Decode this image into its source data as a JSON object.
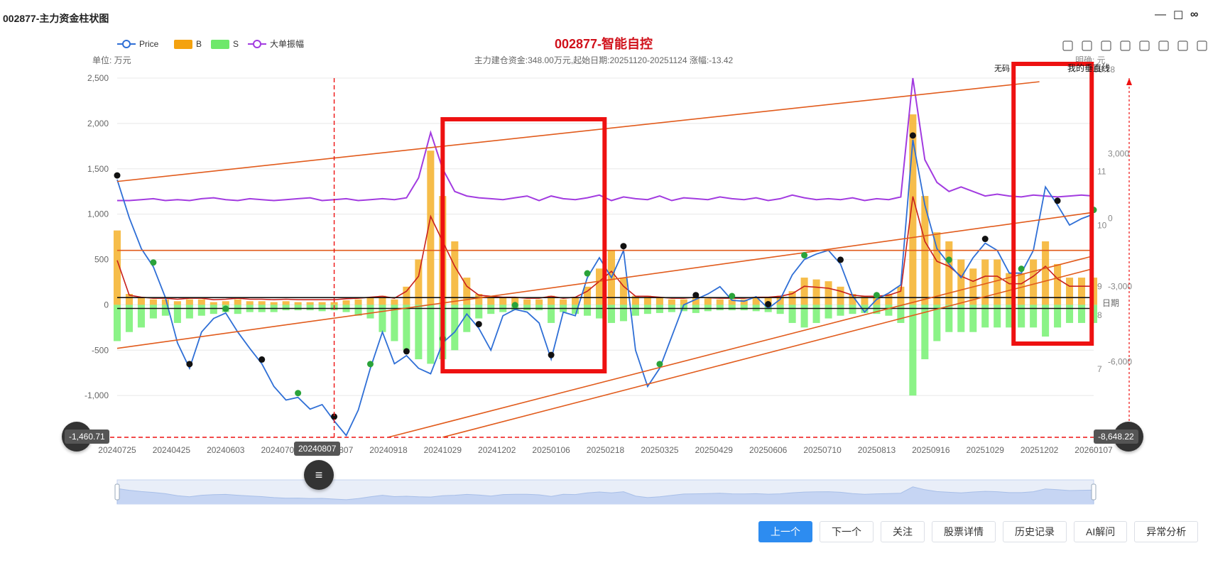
{
  "window": {
    "title": "002877-主力资金柱状图",
    "minimize_glyph": "—",
    "maximize_glyph": "☐",
    "extra_glyph": "∞"
  },
  "chart": {
    "title": "002877-智能自控",
    "subtitle": "主力建仓资金:348.00万元,起始日期:20251120-20251124 涨幅:-13.42",
    "unit_left": "单位: 万元",
    "unit_right": "明确: 元",
    "right_top_value": "58.78",
    "right_axis_label": "日期",
    "vertical_line_label": "我的垂直线",
    "peak_label": "无码",
    "legend": [
      {
        "name": "Price",
        "color": "#2f6fd6",
        "shape": "line"
      },
      {
        "name": "B",
        "color": "#f4a20f",
        "shape": "rect"
      },
      {
        "name": "S",
        "color": "#6ee86a",
        "shape": "rect"
      },
      {
        "name": "大单振幅",
        "color": "#a23be0",
        "shape": "line"
      }
    ],
    "toolbox_icons": [
      "layers-icon",
      "document-icon",
      "zoom-rect-icon",
      "lasso-icon",
      "move-icon",
      "restore-icon",
      "copy-icon",
      "close-box-icon"
    ],
    "crosshair_left_value": "-1,460.71",
    "crosshair_right_value": "-8,648.22",
    "crosshair_date": "20240807",
    "highlight_color": "#ee1111"
  },
  "chart_data": {
    "type": "bar",
    "x_ticks": [
      "20240725",
      "20240425",
      "20240603",
      "20240708",
      "20240807",
      "20240918",
      "20241029",
      "20241202",
      "20250106",
      "20250218",
      "20250325",
      "20250429",
      "20250606",
      "20250710",
      "20250813",
      "20250916",
      "20251029",
      "20251202",
      "20260107"
    ],
    "y_left": {
      "ticks": [
        2500,
        2000,
        1500,
        1000,
        500,
        0,
        -500,
        -1000
      ],
      "labels": [
        "2,500",
        "2,000",
        "1,500",
        "1,000",
        "500",
        "0",
        "-500",
        "-1,000"
      ],
      "ylim": [
        -1460.71,
        2500
      ]
    },
    "y_right_amount": {
      "labels": [
        "3,000",
        "-3,000",
        "-6,000"
      ]
    },
    "y_right_price": {
      "labels": [
        "11",
        "10",
        "9",
        "8",
        "7"
      ]
    },
    "y_right_amp": {
      "labels": [
        "0"
      ]
    },
    "series": [
      {
        "name": "Price",
        "values": [
          1380,
          960,
          620,
          420,
          80,
          -420,
          -700,
          -300,
          -150,
          -90,
          -300,
          -480,
          -650,
          -900,
          -1050,
          -1020,
          -1150,
          -1100,
          -1280,
          -1440,
          -1160,
          -700,
          -300,
          -650,
          -560,
          -700,
          -760,
          -420,
          -300,
          -100,
          -260,
          -500,
          -120,
          -50,
          -80,
          -200,
          -600,
          -80,
          -120,
          300,
          520,
          300,
          600,
          -500,
          -900,
          -700,
          -350,
          0,
          60,
          120,
          200,
          50,
          40,
          90,
          -40,
          60,
          330,
          500,
          560,
          600,
          450,
          100,
          -80,
          60,
          130,
          220,
          1820,
          1100,
          620,
          450,
          300,
          520,
          680,
          600,
          350,
          350,
          600,
          1300,
          1100,
          880,
          950,
          1000
        ]
      },
      {
        "name": "B",
        "values": [
          820,
          120,
          80,
          60,
          60,
          40,
          60,
          60,
          30,
          40,
          60,
          40,
          40,
          30,
          40,
          30,
          30,
          30,
          30,
          50,
          60,
          80,
          100,
          60,
          200,
          500,
          1700,
          1200,
          700,
          300,
          120,
          100,
          80,
          80,
          60,
          60,
          100,
          60,
          80,
          200,
          400,
          600,
          300,
          100,
          100,
          80,
          60,
          60,
          80,
          70,
          60,
          60,
          60,
          80,
          80,
          100,
          150,
          300,
          280,
          260,
          200,
          120,
          100,
          100,
          120,
          200,
          2100,
          1200,
          800,
          700,
          500,
          400,
          500,
          500,
          350,
          350,
          500,
          700,
          450,
          300,
          300,
          300
        ]
      },
      {
        "name": "S",
        "values": [
          -400,
          -300,
          -250,
          -150,
          -120,
          -200,
          -150,
          -120,
          -100,
          -80,
          -100,
          -80,
          -80,
          -80,
          -60,
          -60,
          -60,
          -70,
          -60,
          -80,
          -120,
          -150,
          -300,
          -400,
          -500,
          -600,
          -650,
          -600,
          -500,
          -300,
          -150,
          -100,
          -80,
          -60,
          -60,
          -60,
          -200,
          -80,
          -100,
          -120,
          -150,
          -200,
          -180,
          -120,
          -100,
          -90,
          -80,
          -70,
          -90,
          -70,
          -60,
          -60,
          -60,
          -70,
          -80,
          -100,
          -200,
          -250,
          -200,
          -150,
          -120,
          -100,
          -90,
          -100,
          -120,
          -200,
          -1000,
          -600,
          -400,
          -300,
          -300,
          -300,
          -250,
          -250,
          -250,
          -250,
          -250,
          -350,
          -250,
          -200,
          -200,
          -200
        ]
      },
      {
        "name": "大单振幅",
        "values": [
          1150,
          1150,
          1160,
          1170,
          1150,
          1160,
          1150,
          1170,
          1180,
          1160,
          1150,
          1170,
          1160,
          1150,
          1160,
          1170,
          1180,
          1150,
          1160,
          1170,
          1150,
          1160,
          1170,
          1160,
          1180,
          1400,
          1900,
          1500,
          1250,
          1200,
          1180,
          1170,
          1160,
          1180,
          1200,
          1150,
          1200,
          1170,
          1160,
          1180,
          1210,
          1150,
          1190,
          1170,
          1160,
          1200,
          1150,
          1180,
          1170,
          1160,
          1190,
          1170,
          1160,
          1180,
          1150,
          1170,
          1210,
          1180,
          1160,
          1170,
          1160,
          1180,
          1150,
          1170,
          1160,
          1190,
          2500,
          1600,
          1350,
          1250,
          1300,
          1250,
          1200,
          1220,
          1200,
          1190,
          1210,
          1200,
          1190,
          1200,
          1210,
          1200
        ]
      }
    ],
    "horizontal_lines": [
      {
        "value": 600,
        "color": "#e15b1c"
      },
      {
        "value": 80,
        "color": "#111"
      },
      {
        "value": -40,
        "color": "#111"
      }
    ],
    "trend_lines": [
      {
        "from": [
          "20240725",
          1360
        ],
        "to": [
          "20251202",
          2460
        ]
      },
      {
        "from": [
          "20240725",
          -480
        ],
        "to": [
          "20260107",
          1020
        ]
      },
      {
        "from": [
          "20240918",
          -1460
        ],
        "to": [
          "20260107",
          540
        ]
      },
      {
        "from": [
          "20241029",
          -1460
        ],
        "to": [
          "20260107",
          400
        ]
      }
    ],
    "grid": true,
    "legend_position": "top-left"
  },
  "buttons": [
    {
      "label": "上一个",
      "primary": true
    },
    {
      "label": "下一个",
      "primary": false
    },
    {
      "label": "关注",
      "primary": false
    },
    {
      "label": "股票详情",
      "primary": false
    },
    {
      "label": "历史记录",
      "primary": false
    },
    {
      "label": "AI解问",
      "primary": false
    },
    {
      "label": "异常分析",
      "primary": false
    }
  ]
}
